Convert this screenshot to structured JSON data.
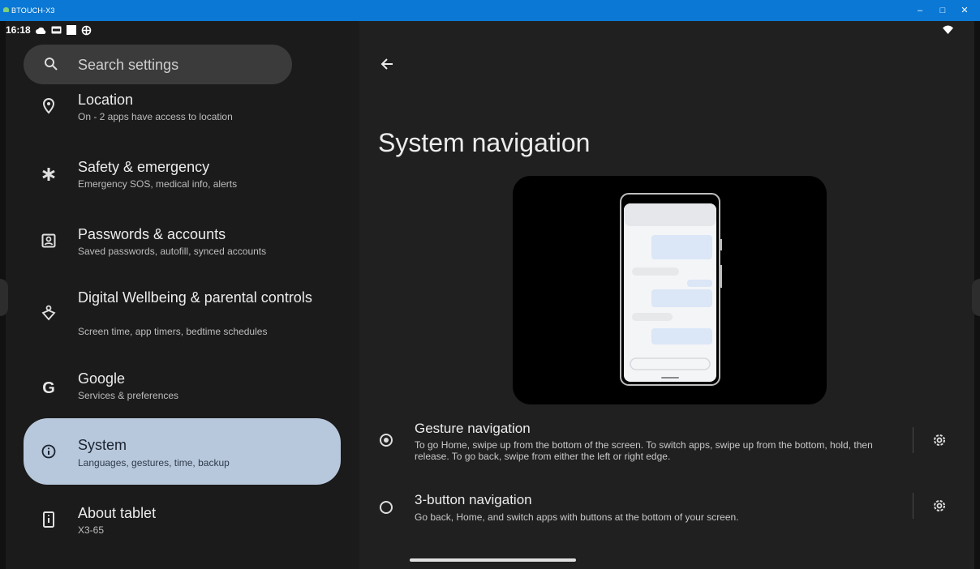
{
  "window": {
    "title": "BTOUCH-X3",
    "minimize": "–",
    "maximize": "□",
    "close": "✕"
  },
  "status_bar": {
    "time": "16:18"
  },
  "search": {
    "placeholder": "Search settings"
  },
  "settings_list": [
    {
      "title": "Location",
      "subtitle": "On - 2 apps have access to location",
      "icon": "location-icon"
    },
    {
      "title": "Safety & emergency",
      "subtitle": "Emergency SOS, medical info, alerts",
      "icon": "asterisk-icon"
    },
    {
      "title": "Passwords & accounts",
      "subtitle": "Saved passwords, autofill, synced accounts",
      "icon": "account-box-icon"
    },
    {
      "title": "Digital Wellbeing & parental controls",
      "subtitle": "Screen time, app timers, bedtime schedules",
      "icon": "wellbeing-icon"
    },
    {
      "title": "Google",
      "subtitle": "Services & preferences",
      "icon": "google-icon"
    },
    {
      "title": "System",
      "subtitle": "Languages, gestures, time, backup",
      "icon": "info-icon",
      "selected": true
    },
    {
      "title": "About tablet",
      "subtitle": "X3-65",
      "icon": "tablet-icon"
    }
  ],
  "page": {
    "title": "System navigation"
  },
  "options": [
    {
      "title": "Gesture navigation",
      "description": "To go Home, swipe up from the bottom of the screen. To switch apps, swipe up from the bottom, hold, then release. To go back, swipe from either the left or right edge.",
      "selected": true
    },
    {
      "title": "3-button navigation",
      "description": "Go back, Home, and switch apps with buttons at the bottom of your screen.",
      "selected": false
    }
  ],
  "colors": {
    "titlebar": "#0a78d4",
    "selected_item": "#b8c8dc",
    "background": "#1f1f1f"
  }
}
